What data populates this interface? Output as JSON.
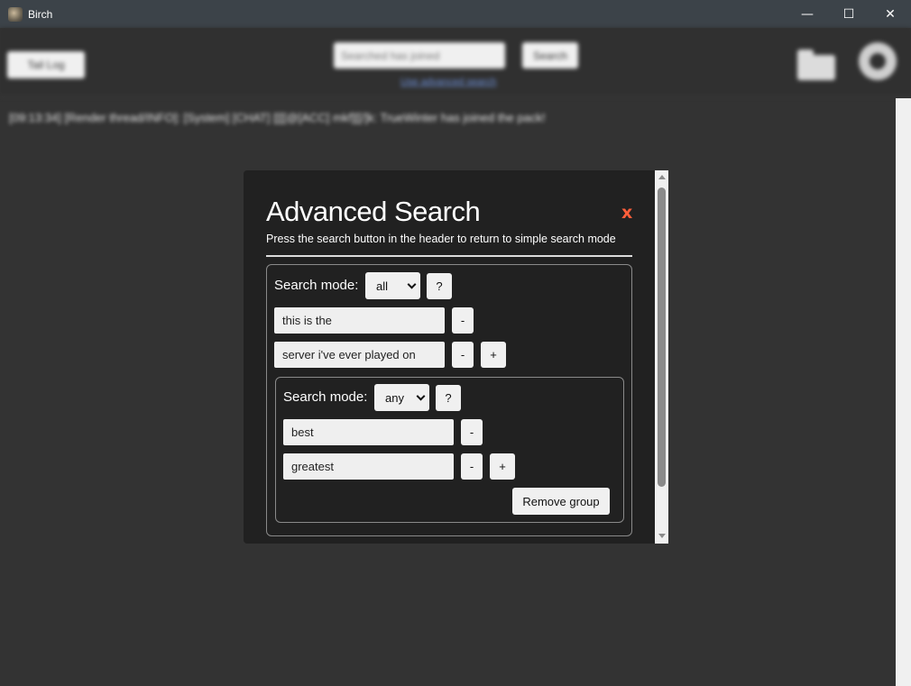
{
  "window": {
    "title": "Birch",
    "minimize_glyph": "—",
    "maximize_glyph": "☐",
    "close_glyph": "✕"
  },
  "header": {
    "left_button_label": "Tail Log",
    "search_placeholder": "Searched has joined",
    "search_button_label": "Search",
    "advanced_link": "Use advanced search",
    "folder_icon": "folder-icon",
    "settings_icon": "gear-icon"
  },
  "log": {
    "line": "[09:13:34] [Render thread/INFO]: [System] [CHAT] [[[[@[ACC] mkf][[/]k: TrueWinter has joined the pack!"
  },
  "modal": {
    "title": "Advanced Search",
    "close_label": "x",
    "subtitle": "Press the search button in the header to return to simple search mode",
    "outer_group": {
      "mode_label": "Search mode:",
      "mode_value": "all",
      "help_label": "?",
      "terms": [
        {
          "value": "this is the",
          "remove_label": "-"
        },
        {
          "value": "server i've ever played on",
          "remove_label": "-",
          "add_label": "+"
        }
      ]
    },
    "inner_group": {
      "mode_label": "Search mode:",
      "mode_value": "any",
      "help_label": "?",
      "terms": [
        {
          "value": "best",
          "remove_label": "-"
        },
        {
          "value": "greatest",
          "remove_label": "-",
          "add_label": "+"
        }
      ],
      "remove_group_label": "Remove group"
    }
  },
  "colors": {
    "close_accent": "#ff5e3a",
    "modal_bg": "#212121",
    "app_bg": "#333333",
    "titlebar_bg": "#3c4349"
  }
}
